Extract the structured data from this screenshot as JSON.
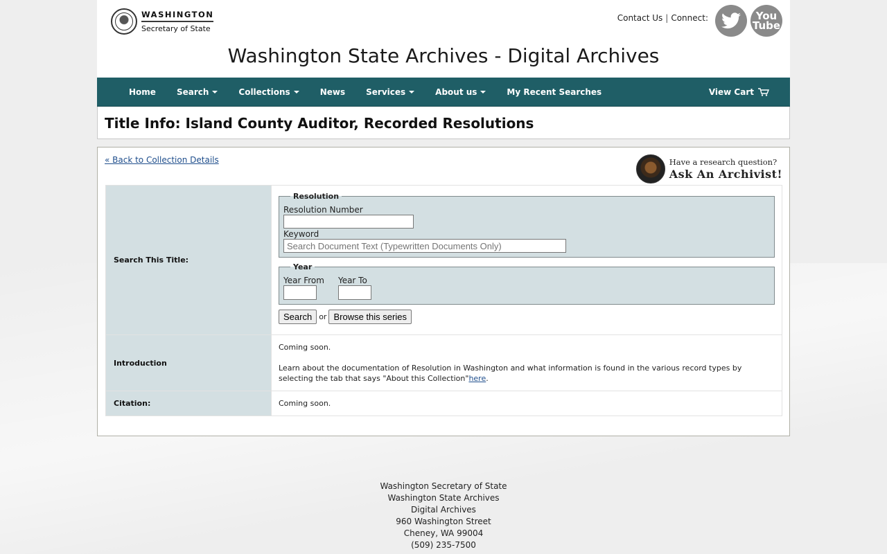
{
  "header": {
    "logo_line1": "WASHINGTON",
    "logo_line2": "Secretary of State",
    "contact_label": "Contact Us",
    "connect_label": "Connect:",
    "youtube_line1": "You",
    "youtube_line2": "Tube",
    "site_title": "Washington State Archives - Digital Archives"
  },
  "nav": {
    "items": [
      {
        "label": "Home"
      },
      {
        "label": "Search"
      },
      {
        "label": "Collections"
      },
      {
        "label": "News"
      },
      {
        "label": "Services"
      },
      {
        "label": "About us"
      },
      {
        "label": "My Recent Searches"
      }
    ],
    "cart_label": "View Cart",
    "background": "#1f5e66"
  },
  "page": {
    "title": "Title Info: Island County Auditor, Recorded Resolutions",
    "back_link": "« Back to Collection Details",
    "ask_line1": "Have a research question?",
    "ask_line2": "Ask An Archivist!"
  },
  "search": {
    "row_label": "Search This Title:",
    "resolution_legend": "Resolution",
    "resolution_number_label": "Resolution Number",
    "resolution_number_value": "",
    "keyword_label": "Keyword",
    "keyword_placeholder": "Search Document Text (Typewritten Documents Only)",
    "year_legend": "Year",
    "year_from_label": "Year From",
    "year_to_label": "Year To",
    "search_button": "Search",
    "or_text": "or",
    "browse_button": "Browse this series"
  },
  "introduction": {
    "row_label": "Introduction",
    "text1": "Coming soon.",
    "text2": "Learn about the documentation of Resolution in Washington and what information is found in the various record types by selecting the tab that says \"About this Collection\"",
    "link": "here",
    "suffix": "."
  },
  "citation": {
    "row_label": "Citation:",
    "text": "Coming soon."
  },
  "footer": {
    "lines": [
      "Washington Secretary of State",
      "Washington State Archives",
      "Digital Archives",
      "960 Washington Street",
      "Cheney, WA 99004",
      "(509) 235-7500"
    ]
  }
}
